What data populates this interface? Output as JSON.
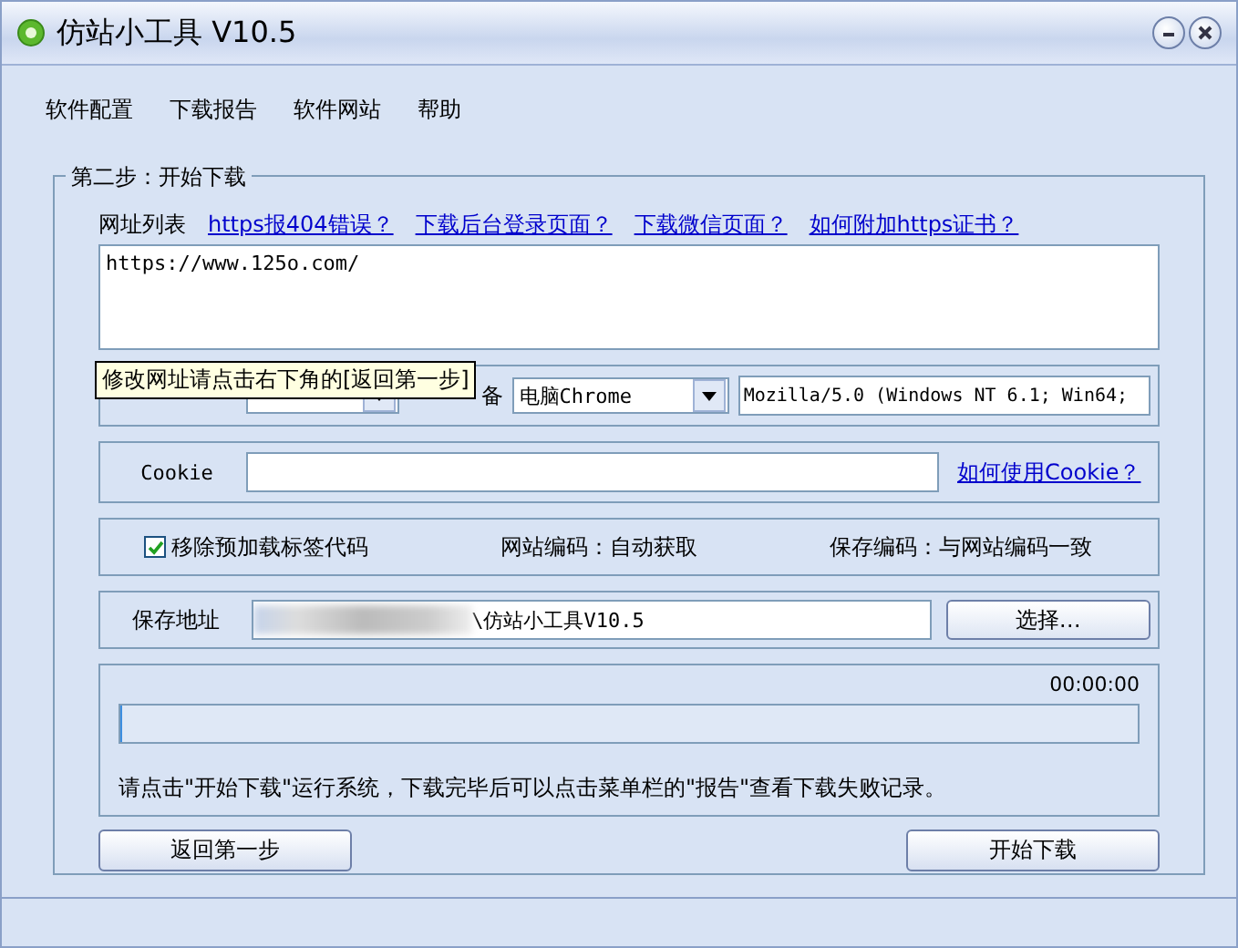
{
  "window": {
    "title": "仿站小工具 V10.5"
  },
  "menu": [
    "软件配置",
    "下载报告",
    "软件网站",
    "帮助"
  ],
  "group": {
    "title": "第二步：开始下载"
  },
  "url_list": {
    "label": "网址列表",
    "links": [
      "https报404错误？",
      "下载后台登录页面？",
      "下载微信页面？",
      "如何附加https证书？"
    ],
    "value": "https://www.125o.com/"
  },
  "tooltip": "修改网址请点击右下角的[返回第一步]",
  "device": {
    "label": "备",
    "value": "电脑Chrome",
    "user_agent": "Mozilla/5.0 (Windows NT 6.1; Win64;"
  },
  "cookie": {
    "label": "Cookie",
    "link": "如何使用Cookie？"
  },
  "options": {
    "remove_preload": {
      "label": "移除预加载标签代码",
      "checked": true
    },
    "site_encoding": "网站编码：自动获取",
    "save_encoding": "保存编码：与网站编码一致"
  },
  "save": {
    "label": "保存地址",
    "value": "\\仿站小工具V10.5",
    "button": "选择…"
  },
  "progress": {
    "time": "00:00:00",
    "level": 0,
    "note": "请点击\"开始下载\"运行系统，下载完毕后可以点击菜单栏的\"报告\"查看下载失败记录。"
  },
  "buttons": {
    "back": "返回第一步",
    "start": "开始下载"
  }
}
